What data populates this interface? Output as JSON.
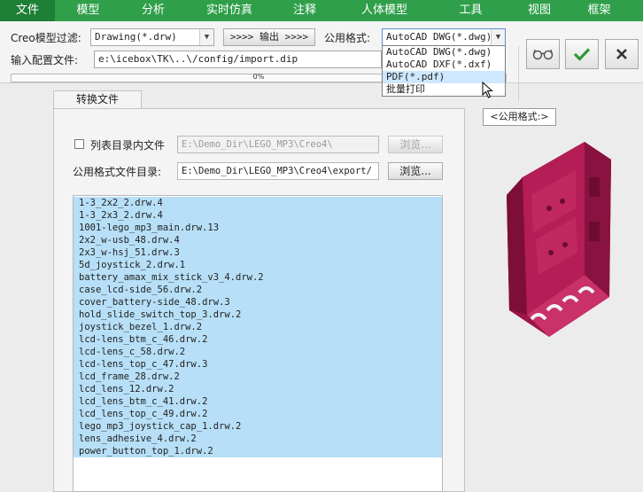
{
  "ribbon": {
    "tabs": [
      {
        "label": "文件",
        "active": true
      },
      {
        "label": "模型"
      },
      {
        "label": "分析"
      },
      {
        "label": "实时仿真"
      },
      {
        "label": "注释"
      },
      {
        "label": "人体模型"
      },
      {
        "label": "工具"
      },
      {
        "label": "视图"
      },
      {
        "label": "框架"
      }
    ]
  },
  "panel": {
    "filter_label": "Creo模型过滤:",
    "filter_value": "Drawing(*.drw)",
    "output_button": ">>>> 输出 >>>>",
    "format_label": "公用格式:",
    "format_value": "AutoCAD DWG(*.dwg)",
    "config_label": "输入配置文件:",
    "config_value": "e:\\icebox\\TK\\..\\/config/import.dip",
    "progress_text": "0%",
    "progress_value": 0
  },
  "dropdown": {
    "options": [
      "AutoCAD DWG(*.dwg)",
      "AutoCAD DXF(*.dxf)",
      "PDF(*.pdf)",
      "批量打印"
    ],
    "selected_index": 2
  },
  "tooltip": "<公用格式:>",
  "convert_tab": "转换文件",
  "list_dir": {
    "checkbox_label": "列表目录内文件",
    "path": "E:\\Demo_Dir\\LEGO_MP3\\Creo4\\",
    "browse": "浏览..."
  },
  "output_dir": {
    "label": "公用格式文件目录:",
    "path": "E:\\Demo_Dir\\LEGO_MP3\\Creo4\\export/",
    "browse": "浏览..."
  },
  "files": [
    "1-3_2x2_2.drw.4",
    "1-3_2x3_2.drw.4",
    "1001-lego_mp3_main.drw.13",
    "2x2_w-usb_48.drw.4",
    "2x3_w-hsj_51.drw.3",
    "5d_joystick_2.drw.1",
    "battery_amax_mix_stick_v3_4.drw.2",
    "case_lcd-side_56.drw.2",
    "cover_battery-side_48.drw.3",
    "hold_slide_switch_top_3.drw.2",
    "joystick_bezel_1.drw.2",
    "lcd-lens_btm_c_46.drw.2",
    "lcd-lens_c_58.drw.2",
    "lcd-lens_top_c_47.drw.3",
    "lcd_frame_28.drw.2",
    "lcd_lens_12.drw.2",
    "lcd_lens_btm_c_41.drw.2",
    "lcd_lens_top_c_49.drw.2",
    "lego_mp3_joystick_cap_1.drw.2",
    "lens_adhesive_4.drw.2",
    "power_button_top_1.drw.2"
  ],
  "colors": {
    "ribbon": "#2f9f4a",
    "ribbon_active": "#1e7f36",
    "selection": "#b7dff7",
    "model": "#a5174f",
    "confirm": "#2a9a35"
  },
  "icons": {
    "preview": "glasses-icon",
    "confirm": "checkmark-icon",
    "cancel": "close-icon"
  }
}
